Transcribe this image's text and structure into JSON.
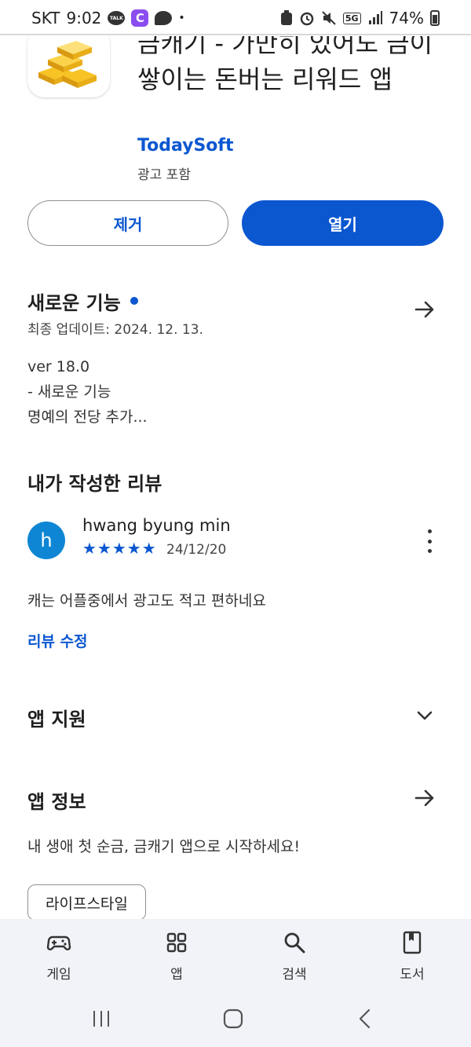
{
  "status_bar": {
    "carrier": "SKT",
    "time": "9:02",
    "talk_label": "TALK",
    "c_label": "C",
    "network": "5G",
    "battery": "74%"
  },
  "app": {
    "title": "금캐기 - 가만히 있어도 금이 쌓이는 돈버는 리워드 앱",
    "developer": "TodaySoft",
    "ads_note": "광고 포함"
  },
  "actions": {
    "remove_label": "제거",
    "open_label": "열기"
  },
  "whats_new": {
    "title": "새로운 기능",
    "last_updated": "최종 업데이트: 2024. 12. 13.",
    "lines": [
      "ver 18.0",
      "- 새로운 기능",
      "명예의 전당 추가..."
    ]
  },
  "my_review": {
    "title": "내가 작성한 리뷰",
    "avatar_letter": "h",
    "reviewer": "hwang byung min",
    "stars": "★★★★★",
    "rating": 5,
    "date": "24/12/20",
    "text": "캐는 어플중에서 광고도 적고 편하네요",
    "edit_label": "리뷰 수정"
  },
  "app_support": {
    "title": "앱 지원"
  },
  "app_info": {
    "title": "앱 정보",
    "description": "내 생애 첫 순금, 금캐기 앱으로 시작하세요!",
    "category_chip": "라이프스타일"
  },
  "bottom_nav": {
    "items": [
      {
        "label": "게임",
        "icon": "gamepad-icon"
      },
      {
        "label": "앱",
        "icon": "apps-grid-icon"
      },
      {
        "label": "검색",
        "icon": "search-icon"
      },
      {
        "label": "도서",
        "icon": "book-icon"
      }
    ]
  },
  "colors": {
    "accent": "#0b57d0",
    "avatar": "#0e86d4",
    "nav_bg": "#f1f3f8"
  }
}
